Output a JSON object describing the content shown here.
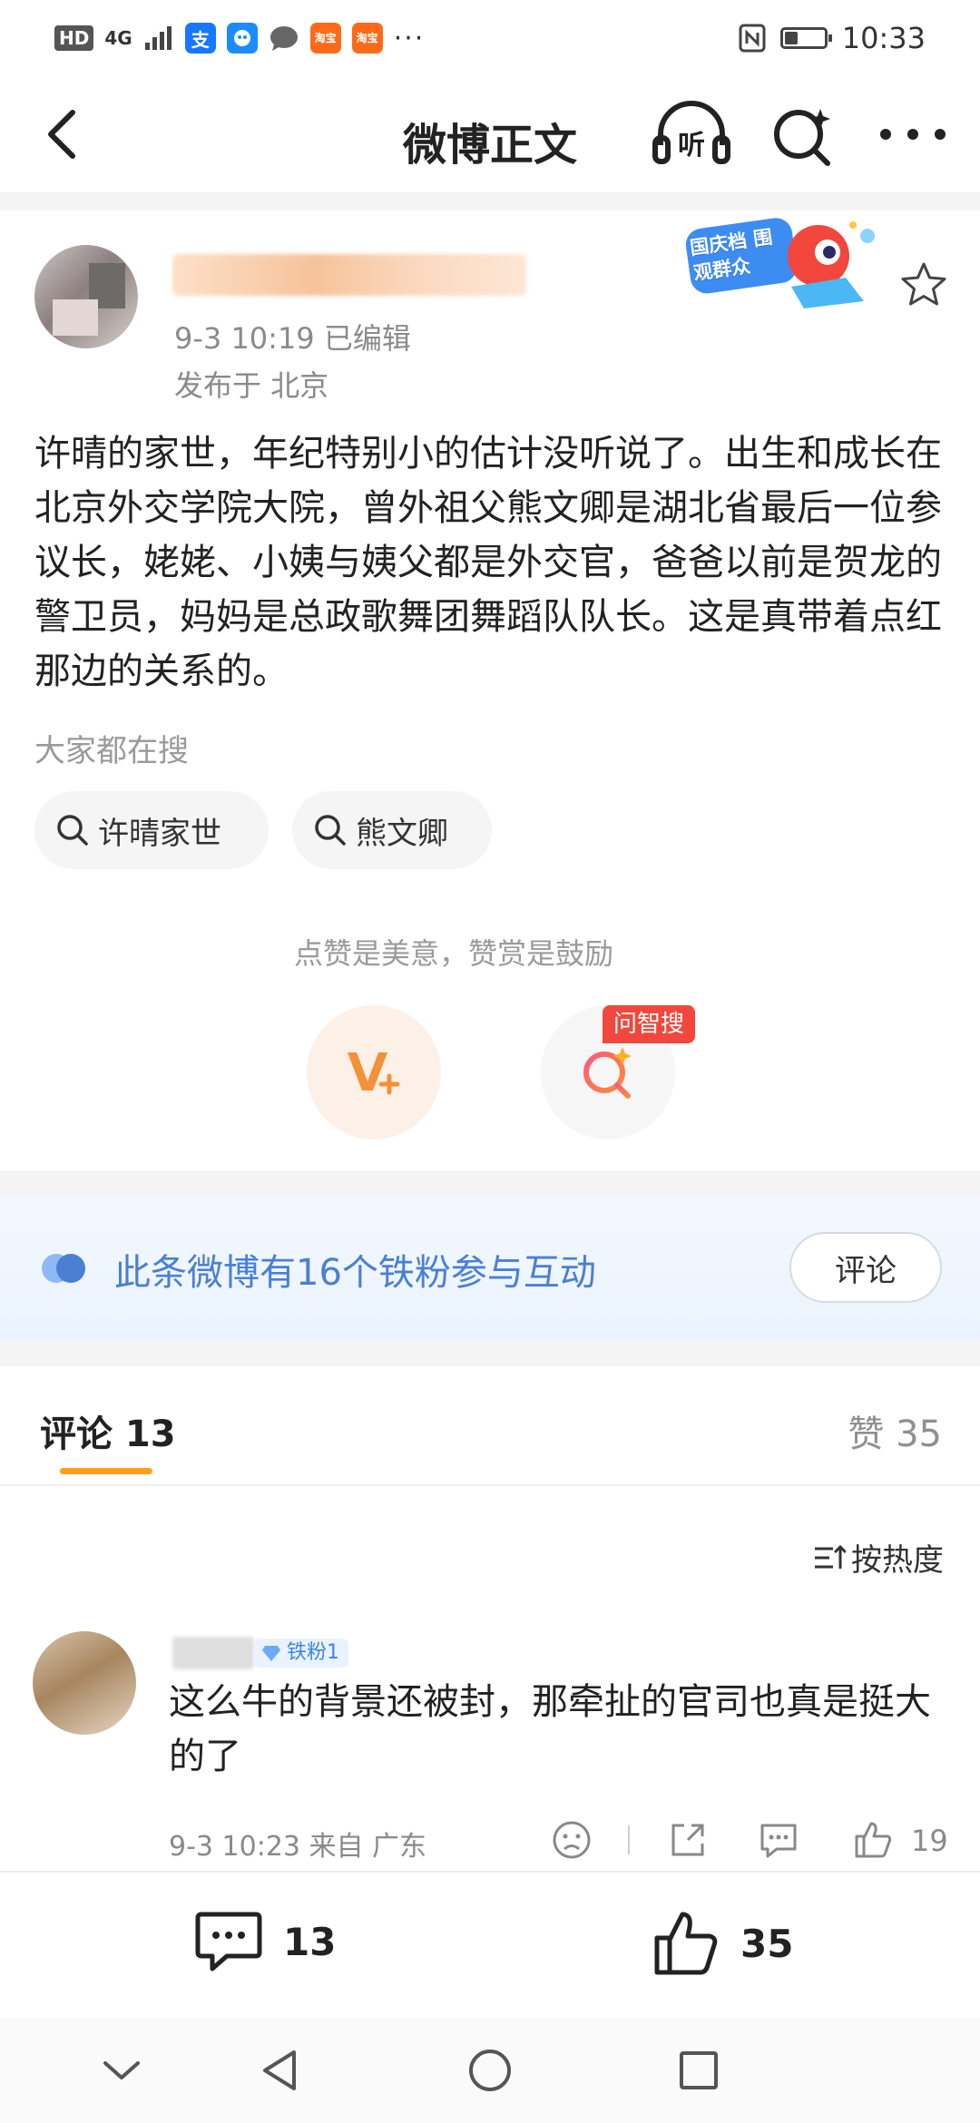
{
  "status_bar": {
    "hd": "HD",
    "network": "4G",
    "alipay_glyph": "支",
    "taobao_label": "淘宝",
    "more": "···",
    "time": "10:33",
    "battery_level": 0.3
  },
  "nav": {
    "title": "微博正文",
    "listen_label": "听"
  },
  "post": {
    "time": "9-3 10:19  已编辑",
    "location": "发布于 北京",
    "badge_text": "国庆档 围观群众",
    "body": "许晴的家世，年纪特别小的估计没听说了。出生和成长在北京外交学院大院，曾外祖父熊文卿是湖北省最后一位参议长，姥姥、小姨与姨父都是外交官，爸爸以前是贺龙的警卫员，妈妈是总政歌舞团舞蹈队队长。这是真带着点红那边的关系的。"
  },
  "hot_search": {
    "label": "大家都在搜",
    "tags": [
      "许晴家世",
      "熊文卿"
    ]
  },
  "reward": {
    "hint": "点赞是美意，赞赏是鼓励",
    "ask_tag": "问智搜"
  },
  "fans_banner": {
    "text": "此条微博有16个铁粉参与互动",
    "button": "评论"
  },
  "tabs": {
    "comments": "评论 13",
    "likes": "赞 35"
  },
  "sort": {
    "label": "按热度"
  },
  "comment": {
    "badge": "铁粉1",
    "text": "这么牛的背景还被封，那牵扯的官司也真是挺大的了",
    "meta": "9-3 10:23  来自 广东",
    "like_count": "19"
  },
  "bottom_bar": {
    "comment_count": "13",
    "like_count": "35"
  },
  "colors": {
    "accent_orange": "#ff9f1a",
    "fans_blue": "#4a7fd4",
    "ask_red": "#f2473c"
  }
}
